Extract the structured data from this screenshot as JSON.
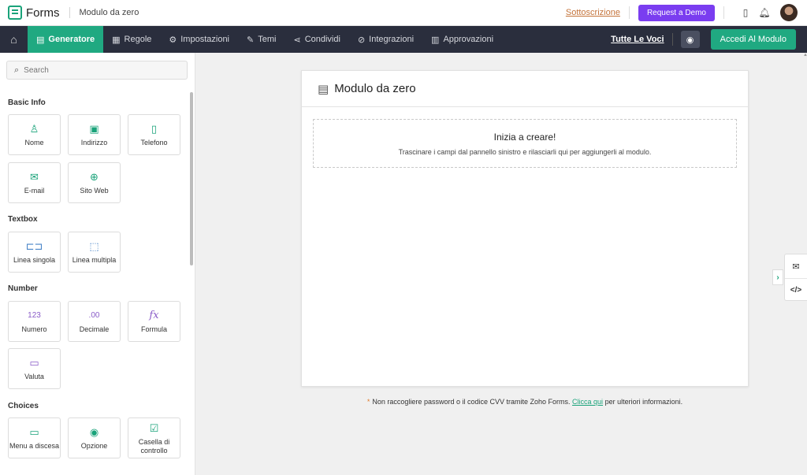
{
  "topbar": {
    "brand": "Forms",
    "form_name": "Modulo da zero",
    "subscription_link": "Sottoscrizione",
    "demo_button": "Request a Demo"
  },
  "nav": {
    "items": [
      {
        "label": "Generatore",
        "icon": "builder-icon"
      },
      {
        "label": "Regole",
        "icon": "rules-icon"
      },
      {
        "label": "Impostazioni",
        "icon": "settings-icon"
      },
      {
        "label": "Temi",
        "icon": "themes-icon"
      },
      {
        "label": "Condividi",
        "icon": "share-icon"
      },
      {
        "label": "Integrazioni",
        "icon": "integrations-icon"
      },
      {
        "label": "Approvazioni",
        "icon": "approvals-icon"
      }
    ],
    "all_entries_link": "Tutte Le Voci",
    "access_button": "Accedi Al Modulo"
  },
  "sidebar": {
    "search_placeholder": "Search",
    "sections": {
      "basic": {
        "title": "Basic Info",
        "fields": [
          "Nome",
          "Indirizzo",
          "Telefono",
          "E-mail",
          "Sito Web"
        ]
      },
      "textbox": {
        "title": "Textbox",
        "fields": [
          "Linea singola",
          "Linea multipla"
        ]
      },
      "number": {
        "title": "Number",
        "fields": [
          "Numero",
          "Decimale",
          "Formula",
          "Valuta"
        ]
      },
      "choices": {
        "title": "Choices",
        "fields": [
          "Menu a discesa",
          "Opzione",
          "Casella di controllo"
        ]
      }
    },
    "number_icons": {
      "numero": "123",
      "decimale": ".00",
      "formula": "fx"
    }
  },
  "canvas": {
    "title": "Modulo da zero",
    "drop_title": "Inizia a creare!",
    "drop_subtitle": "Trascinare i campi dal pannello sinistro e rilasciarli qui per aggiungerli al modulo."
  },
  "note": {
    "text": "Non raccogliere password o il codice CVV tramite Zoho Forms.",
    "link": "Clicca qui",
    "suffix": "per ulteriori informazioni."
  },
  "colors": {
    "accent": "#20a981",
    "nav_bg": "#2a2e3d",
    "demo": "#7a3df0"
  }
}
